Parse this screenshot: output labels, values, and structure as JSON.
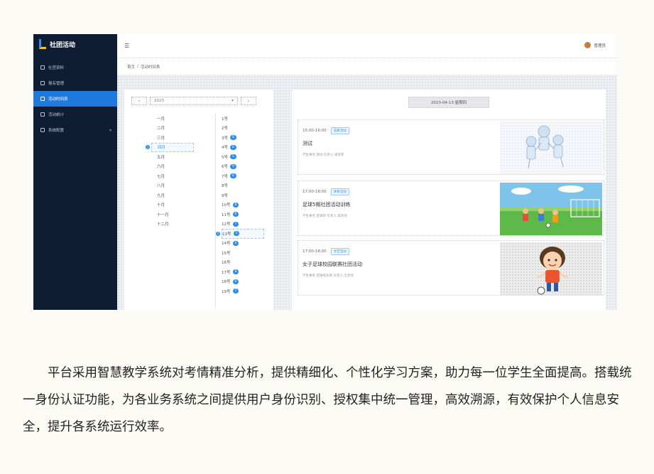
{
  "app": {
    "logo_text": "社团活动"
  },
  "sidebar": {
    "items": [
      {
        "label": "社团资料",
        "icon": "home-icon"
      },
      {
        "label": "报名管理",
        "icon": "user-icon"
      },
      {
        "label": "活动时间表",
        "icon": "calendar-icon",
        "active": true
      },
      {
        "label": "活动统计",
        "icon": "chart-icon"
      },
      {
        "label": "系统配置",
        "icon": "settings-icon",
        "has_children": true
      }
    ]
  },
  "topbar": {
    "fold_icon": "☰",
    "user_name": "管理员"
  },
  "breadcrumb": {
    "home": "首页",
    "separator": "/",
    "current": "活动时间表"
  },
  "calendar": {
    "prev_label": "‹",
    "next_label": "›",
    "year": "2023",
    "months": [
      "一月",
      "二月",
      "三月",
      "四月",
      "五月",
      "六月",
      "七月",
      "八月",
      "九月",
      "十月",
      "十一月",
      "十二月"
    ],
    "selected_month_index": 3,
    "selected_month_marker": "1",
    "days": [
      {
        "label": "1号",
        "count": ""
      },
      {
        "label": "2号",
        "count": ""
      },
      {
        "label": "3号",
        "count": "8"
      },
      {
        "label": "4号",
        "count": "6"
      },
      {
        "label": "5号",
        "count": "5"
      },
      {
        "label": "6号",
        "count": "9"
      },
      {
        "label": "7号",
        "count": "6"
      },
      {
        "label": "8号",
        "count": ""
      },
      {
        "label": "9号",
        "count": ""
      },
      {
        "label": "10号",
        "count": "8"
      },
      {
        "label": "11号",
        "count": "6"
      },
      {
        "label": "12号",
        "count": "7"
      },
      {
        "label": "13号",
        "count": "3"
      },
      {
        "label": "14号",
        "count": "4"
      },
      {
        "label": "15号",
        "count": ""
      },
      {
        "label": "16号",
        "count": ""
      },
      {
        "label": "17号",
        "count": "8"
      },
      {
        "label": "18号",
        "count": "6"
      },
      {
        "label": "19号",
        "count": "7"
      }
    ],
    "selected_day_index": 12,
    "selected_day_marker": "1"
  },
  "events_panel": {
    "date_header": "2023-04-13 星期四",
    "events": [
      {
        "time": "15:00-16:00",
        "tag": "志愿活动",
        "title": "测试",
        "meta": "学生事务 测试   负责人:张老师"
      },
      {
        "time": "17:00-18:00",
        "tag": "体育活动",
        "title": "足球5期社团活动训练",
        "meta": "学生事务 足球场   负责人:李老师"
      },
      {
        "time": "17:00-18:00",
        "tag": "文艺活动",
        "title": "女子足球校园联赛社团活动",
        "meta": "学生事务 足球场东侧   负责人:王老师"
      }
    ]
  },
  "caption": {
    "paragraph": "平台采用智慧教学系统对考情精准分析，提供精细化、个性化学习方案，助力每一位学生全面提高。搭载统一身份认证功能，为各业务系统之间提供用户身份识别、授权集中统一管理，高效溯源，有效保护个人信息安全，提升各系统运行效率。"
  },
  "colors": {
    "sidebar_bg": "#0e1d33",
    "accent": "#2d8cf0",
    "page_bg": "#fdfbf6"
  }
}
